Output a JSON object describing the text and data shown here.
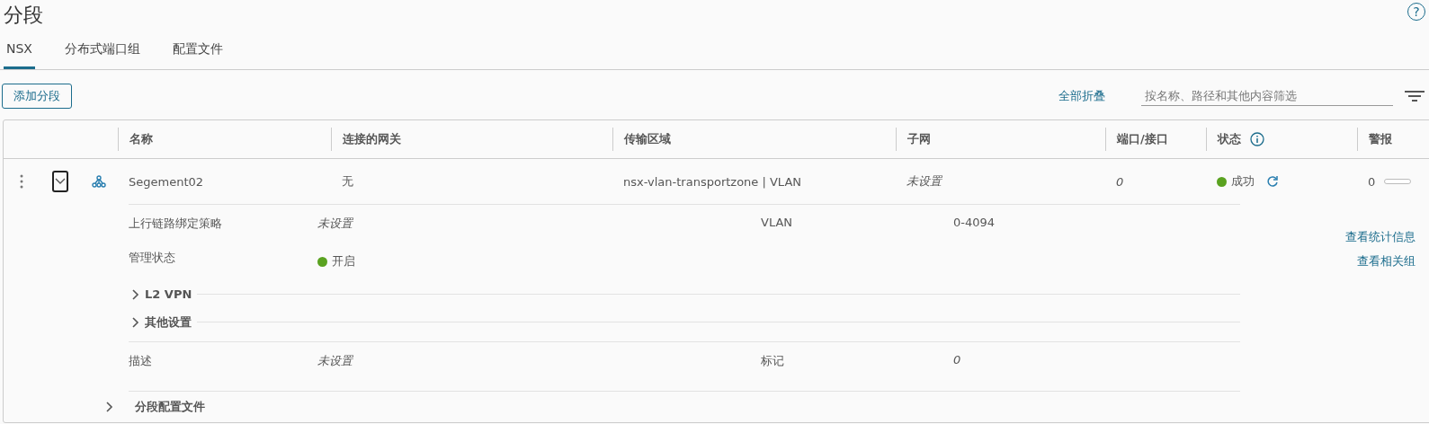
{
  "page": {
    "title": "分段",
    "help": "?"
  },
  "tabs": [
    {
      "label": "NSX",
      "selected": true
    },
    {
      "label": "分布式端口组",
      "selected": false
    },
    {
      "label": "配置文件",
      "selected": false
    }
  ],
  "toolbar": {
    "add_button": "添加分段",
    "collapse_all": "全部折叠",
    "filter": {
      "placeholder": "按名称、路径和其他内容筛选"
    }
  },
  "table": {
    "columns": [
      "名称",
      "连接的网关",
      "传输区域",
      "子网",
      "端口/接口",
      "状态",
      "警报"
    ],
    "rows": [
      {
        "name": "Segement02",
        "gateway": "无",
        "transport_zone": "nsx-vlan-transportzone | VLAN",
        "subnet": {
          "text": "未设置",
          "kind": "placeholder"
        },
        "ports": {
          "text": "0",
          "kind": "placeholder"
        },
        "status": {
          "text": "成功",
          "color": "#5aa220"
        },
        "alarms": "0",
        "expanded": true,
        "details": {
          "fields": [
            {
              "label": "上行链路绑定策略",
              "value": {
                "text": "未设置",
                "kind": "placeholder"
              },
              "label2": "VLAN",
              "value2": {
                "text": "0-4094",
                "kind": "text"
              }
            },
            {
              "label": "管理状态",
              "value": {
                "text": "开启",
                "kind": "status",
                "color": "#5aa220"
              }
            }
          ],
          "sections": [
            {
              "label": "L2 VPN",
              "expanded": false
            },
            {
              "label": "其他设置",
              "expanded": false
            }
          ],
          "description": {
            "label": "描述",
            "value": {
              "text": "未设置",
              "kind": "placeholder"
            },
            "label2": "标记",
            "value2": {
              "text": "0",
              "kind": "placeholder"
            }
          },
          "links": [
            "查看统计信息",
            "查看相关组"
          ],
          "profile": {
            "label": "分段配置文件",
            "expanded": false
          }
        }
      }
    ]
  }
}
